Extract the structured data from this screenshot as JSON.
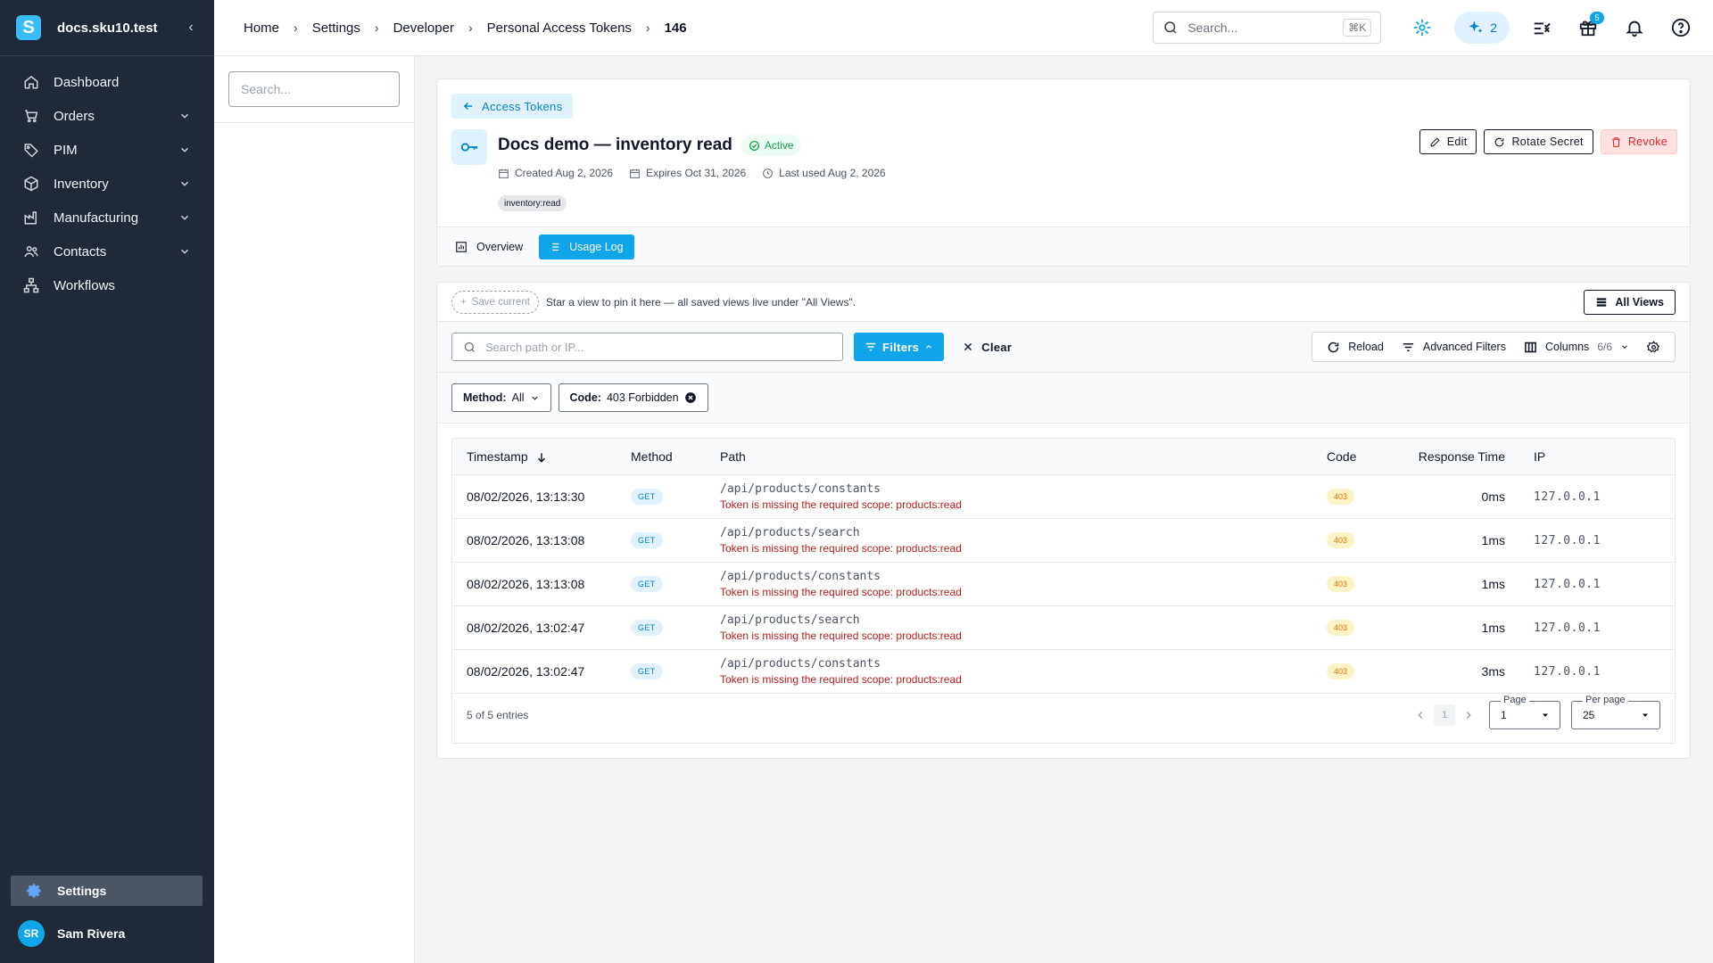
{
  "brand": {
    "name": "docs.sku10.test",
    "logo_letter": "S"
  },
  "sidebar": {
    "items": [
      {
        "label": "Dashboard",
        "icon": "home-icon",
        "has_children": false
      },
      {
        "label": "Orders",
        "icon": "cart-icon",
        "has_children": true
      },
      {
        "label": "PIM",
        "icon": "tag-icon",
        "has_children": true
      },
      {
        "label": "Inventory",
        "icon": "box-icon",
        "has_children": true
      },
      {
        "label": "Manufacturing",
        "icon": "factory-icon",
        "has_children": true
      },
      {
        "label": "Contacts",
        "icon": "people-icon",
        "has_children": true
      },
      {
        "label": "Workflows",
        "icon": "workflow-icon",
        "has_children": false
      }
    ],
    "settings_label": "Settings",
    "user": {
      "initials": "SR",
      "name": "Sam Rivera"
    }
  },
  "topbar": {
    "breadcrumbs": [
      "Home",
      "Settings",
      "Developer",
      "Personal Access Tokens",
      "146"
    ],
    "search_placeholder": "Search...",
    "search_shortcut": "⌘K",
    "ai_count": "2",
    "gift_count": "5"
  },
  "subpanel": {
    "search_placeholder": "Search..."
  },
  "token": {
    "back_label": "Access Tokens",
    "title": "Docs demo — inventory read",
    "status": "Active",
    "created": "Created Aug 2, 2026",
    "expires": "Expires Oct 31, 2026",
    "last_used": "Last used Aug 2, 2026",
    "scope": "inventory:read",
    "actions": {
      "edit": "Edit",
      "rotate": "Rotate Secret",
      "revoke": "Revoke"
    },
    "tabs": {
      "overview": "Overview",
      "usage_log": "Usage Log"
    }
  },
  "log": {
    "save_current": "Save current",
    "views_hint": "Star a view to pin it here — all saved views live under \"All Views\".",
    "all_views": "All Views",
    "search_placeholder": "Search path or IP...",
    "filters_label": "Filters",
    "clear_label": "Clear",
    "reload_label": "Reload",
    "advanced_filters_label": "Advanced Filters",
    "columns_label": "Columns",
    "columns_count": "6/6",
    "chips": {
      "method_key": "Method:",
      "method_value": "All",
      "code_key": "Code:",
      "code_value": "403 Forbidden"
    },
    "headers": [
      "Timestamp",
      "Method",
      "Path",
      "Code",
      "Response Time",
      "IP"
    ],
    "rows": [
      {
        "timestamp": "08/02/2026, 13:13:30",
        "method": "GET",
        "path": "/api/products/constants",
        "error": "Token is missing the required scope: products:read",
        "code": "403",
        "response": "0ms",
        "ip": "127.0.0.1"
      },
      {
        "timestamp": "08/02/2026, 13:13:08",
        "method": "GET",
        "path": "/api/products/search",
        "error": "Token is missing the required scope: products:read",
        "code": "403",
        "response": "1ms",
        "ip": "127.0.0.1"
      },
      {
        "timestamp": "08/02/2026, 13:13:08",
        "method": "GET",
        "path": "/api/products/constants",
        "error": "Token is missing the required scope: products:read",
        "code": "403",
        "response": "1ms",
        "ip": "127.0.0.1"
      },
      {
        "timestamp": "08/02/2026, 13:02:47",
        "method": "GET",
        "path": "/api/products/search",
        "error": "Token is missing the required scope: products:read",
        "code": "403",
        "response": "1ms",
        "ip": "127.0.0.1"
      },
      {
        "timestamp": "08/02/2026, 13:02:47",
        "method": "GET",
        "path": "/api/products/constants",
        "error": "Token is missing the required scope: products:read",
        "code": "403",
        "response": "3ms",
        "ip": "127.0.0.1"
      }
    ],
    "footer": {
      "entries": "5 of 5 entries",
      "current_page": "1",
      "page_label": "Page",
      "page_value": "1",
      "per_page_label": "Per page",
      "per_page_value": "25"
    }
  },
  "colors": {
    "accent": "#0ea5e9",
    "sidebar_bg": "#1f2937",
    "danger": "#dc2626",
    "success": "#16a34a",
    "warning": "#d97706"
  }
}
